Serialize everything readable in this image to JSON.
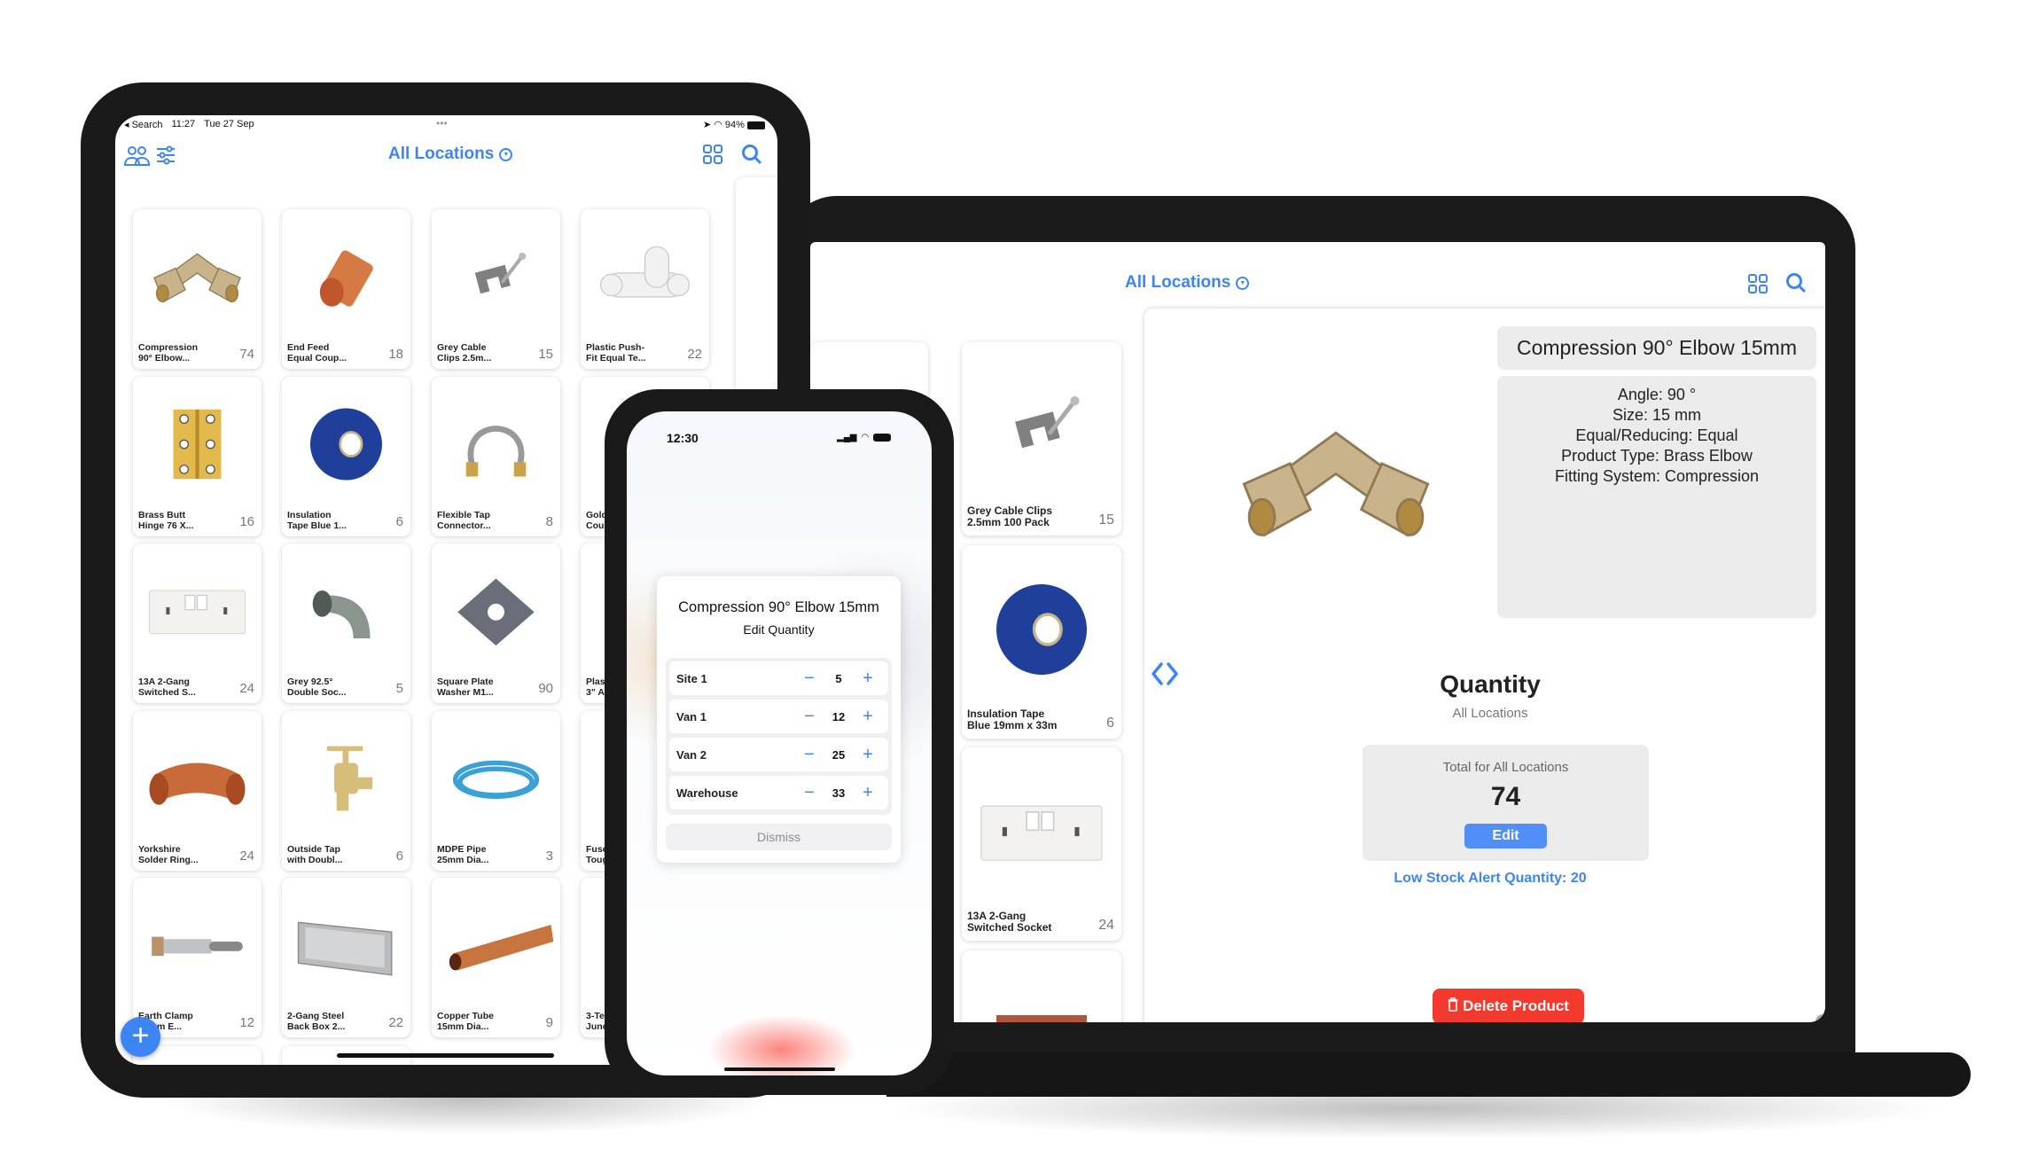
{
  "colors": {
    "accent": "#3d85f5",
    "danger": "#f4392e"
  },
  "laptop": {
    "header": {
      "location_filter": "All Locations",
      "icons": [
        "grid-icon",
        "search-icon"
      ]
    },
    "list": [
      {
        "name": "Grey Cable Clips\n2.5mm 100 Pack",
        "qty": "15",
        "image": "cable-clip"
      },
      {
        "name": "Insulation Tape\nBlue 19mm x 33m",
        "qty": "6",
        "image": "blue-tape"
      },
      {
        "name": "13A 2-Gang\nSwitched Socket",
        "qty": "24",
        "image": "socket"
      },
      {
        "name": "",
        "qty": "",
        "image": "air-brick"
      }
    ],
    "detail": {
      "title": "Compression 90° Elbow 15mm",
      "attributes": [
        "Angle: 90 °",
        "Size: 15 mm",
        "Equal/Reducing: Equal",
        "Product Type: Brass Elbow",
        "Fitting System: Compression"
      ],
      "quantity_heading": "Quantity",
      "quantity_sub": "All Locations",
      "total_label": "Total for All Locations",
      "total_value": "74",
      "edit_label": "Edit",
      "low_stock": "Low Stock Alert Quantity: 20",
      "delete_label": "Delete Product"
    }
  },
  "ipad": {
    "status": {
      "back": "Search",
      "time": "11:27",
      "date": "Tue 27 Sep",
      "battery": "94%"
    },
    "header": {
      "location_filter": "All Locations"
    },
    "products": [
      {
        "name": "Compression\n90° Elbow...",
        "qty": "74",
        "image": "brass-elbow"
      },
      {
        "name": "End Feed\nEqual Coup...",
        "qty": "18",
        "image": "copper-coupler"
      },
      {
        "name": "Grey Cable\nClips 2.5m...",
        "qty": "15",
        "image": "cable-clip"
      },
      {
        "name": "Plastic Push-\nFit Equal Te...",
        "qty": "22",
        "image": "white-tee"
      },
      {
        "name": "Brass Butt\nHinge 76 X...",
        "qty": "16",
        "image": "brass-hinge"
      },
      {
        "name": "Insulation\nTape Blue 1...",
        "qty": "6",
        "image": "blue-tape"
      },
      {
        "name": "Flexible Tap\nConnector...",
        "qty": "8",
        "image": "flexible-hose"
      },
      {
        "name": "Gold\nCou",
        "qty": "",
        "image": "screw"
      },
      {
        "name": "13A 2-Gang\nSwitched S...",
        "qty": "24",
        "image": "socket"
      },
      {
        "name": "Grey 92.5°\nDouble Soc...",
        "qty": "5",
        "image": "grey-bend"
      },
      {
        "name": "Square Plate\nWasher M1...",
        "qty": "90",
        "image": "square-washer"
      },
      {
        "name": "Plast\n3\" Ai",
        "qty": "",
        "image": "air-brick"
      },
      {
        "name": "Yorkshire\nSolder Ring...",
        "qty": "24",
        "image": "copper-elbow"
      },
      {
        "name": "Outside Tap\nwith Doubl...",
        "qty": "6",
        "image": "brass-tap"
      },
      {
        "name": "MDPE Pipe\n25mm Dia...",
        "qty": "3",
        "image": "blue-coil"
      },
      {
        "name": "Fuse\nToug",
        "qty": "",
        "image": "black-box"
      },
      {
        "name": "Earth Clamp\n12mm E...",
        "qty": "12",
        "image": "earth-clamp"
      },
      {
        "name": "2-Gang Steel\nBack Box 2...",
        "qty": "22",
        "image": "steel-box"
      },
      {
        "name": "Copper Tube\n15mm Dia...",
        "qty": "9",
        "image": "copper-tube"
      },
      {
        "name": "3-Te\nJunc",
        "qty": "",
        "image": "black-box"
      }
    ]
  },
  "phone": {
    "status": {
      "time": "12:30"
    },
    "dialog": {
      "title": "Compression 90° Elbow 15mm",
      "subtitle": "Edit Quantity",
      "rows": [
        {
          "location": "Site 1",
          "qty": "5"
        },
        {
          "location": "Van 1",
          "qty": "12"
        },
        {
          "location": "Van 2",
          "qty": "25"
        },
        {
          "location": "Warehouse",
          "qty": "33"
        }
      ],
      "dismiss_label": "Dismiss"
    }
  }
}
